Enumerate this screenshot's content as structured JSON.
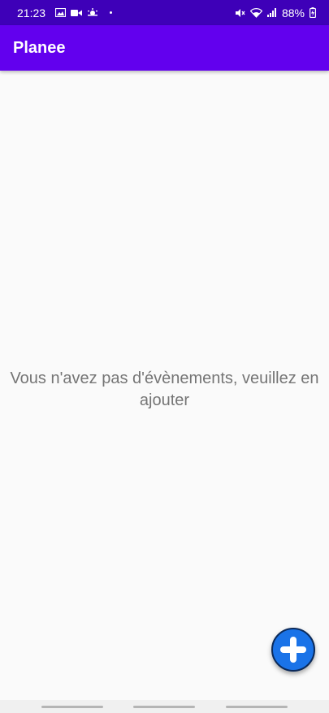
{
  "status_bar": {
    "time": "21:23",
    "battery": "88%",
    "icons": [
      "gallery-icon",
      "video-icon",
      "weather-icon",
      "mute-icon",
      "wifi-icon",
      "signal-icon",
      "battery-icon"
    ]
  },
  "app_bar": {
    "title": "Planee"
  },
  "main": {
    "empty_message": "Vous n'avez pas d'évènements, veuillez en ajouter"
  },
  "fab": {
    "icon": "plus-icon"
  },
  "colors": {
    "status_bar": "#3e00b8",
    "app_bar": "#6200ee",
    "fab": "#1a73e8",
    "background": "#fafafa",
    "empty_text": "#757575"
  }
}
